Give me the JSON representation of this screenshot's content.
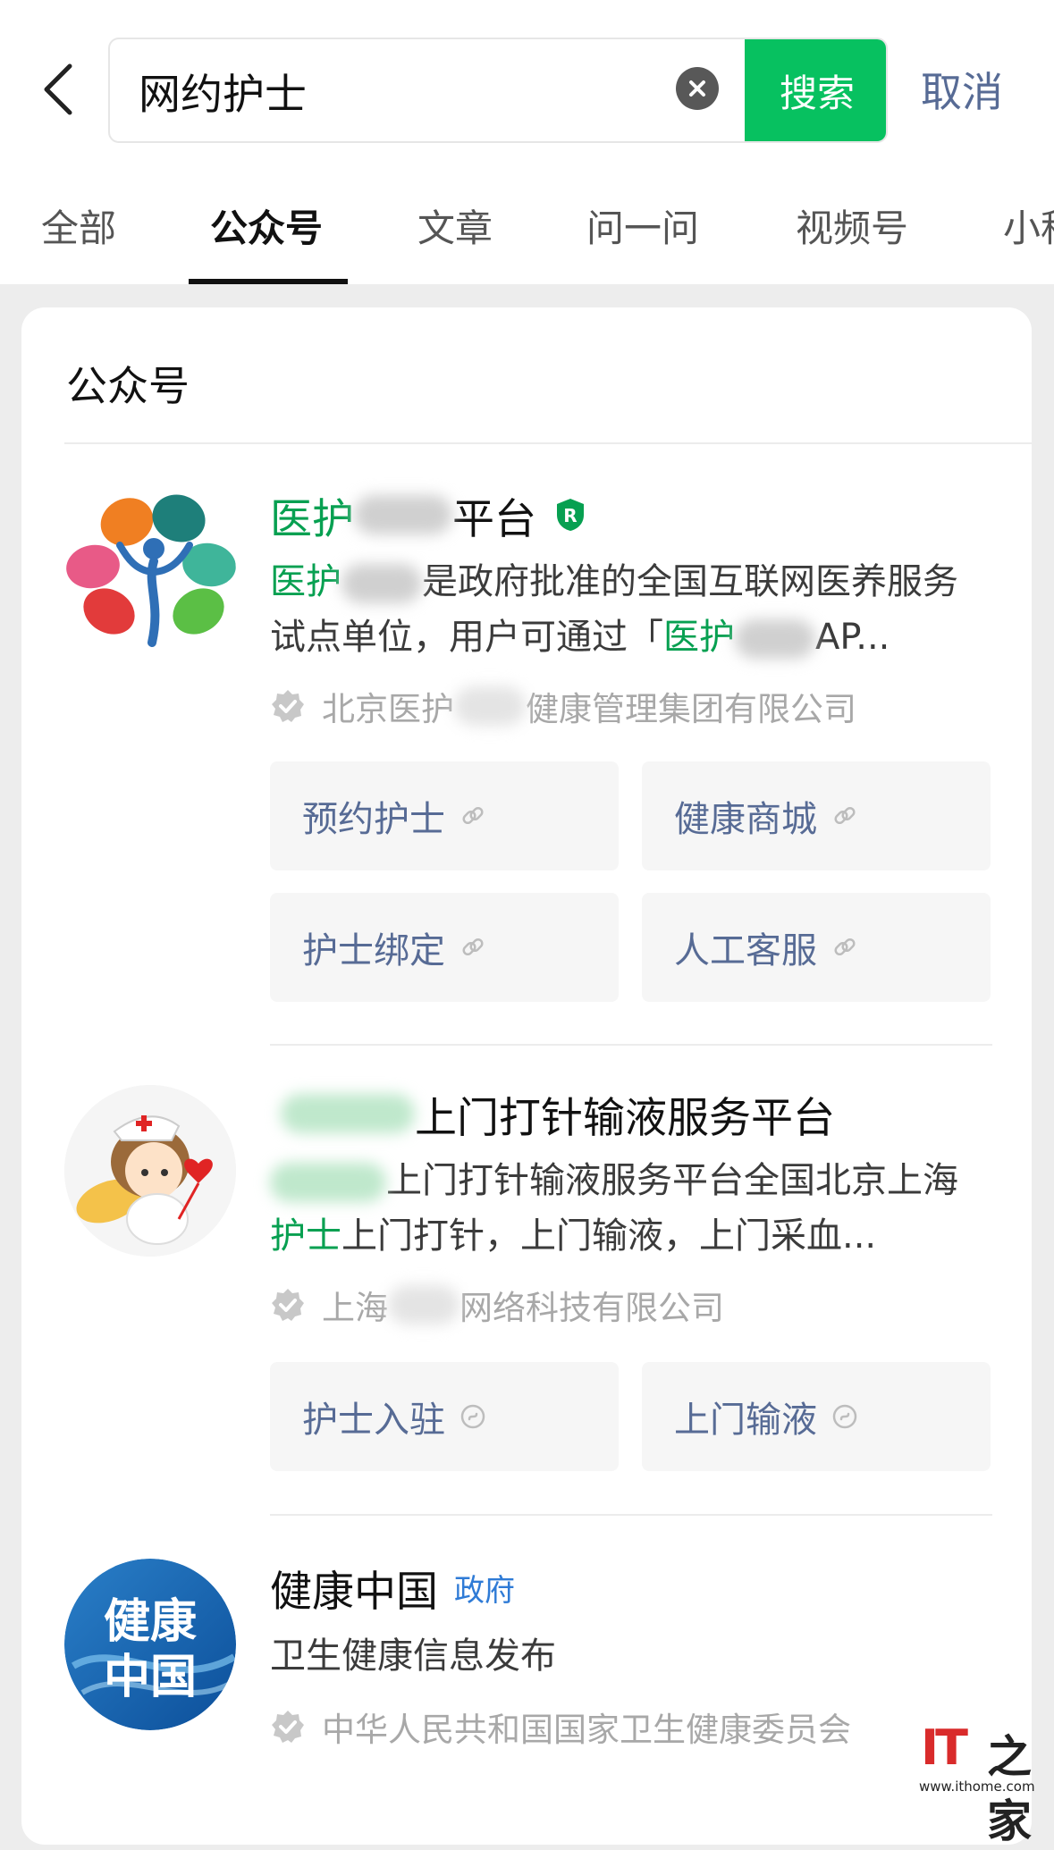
{
  "search": {
    "query": "网约护士",
    "submit_label": "搜索",
    "cancel_label": "取消"
  },
  "tabs": [
    {
      "label": "全部",
      "active": false
    },
    {
      "label": "公众号",
      "active": true
    },
    {
      "label": "文章",
      "active": false
    },
    {
      "label": "问一问",
      "active": false
    },
    {
      "label": "视频号",
      "active": false
    },
    {
      "label": "小程",
      "active": false
    }
  ],
  "results": {
    "section_title": "公众号",
    "accounts": [
      {
        "name_prefix": "医护",
        "name_suffix": "平台",
        "badge": "R",
        "desc_prefix": "医护",
        "desc_text": "是政府批准的全国互联网医养服务试点单位，用户可通过「",
        "desc_highlight": "医护",
        "desc_end": "AP...",
        "org_prefix": "北京医护",
        "org_suffix": "健康管理集团有限公司",
        "menu": [
          "预约护士",
          "健康商城",
          "护士绑定",
          "人工客服"
        ]
      },
      {
        "name_suffix": "上门打针输液服务平台",
        "desc_text": "上门打针输液服务平台全国北京上海",
        "desc_highlight": "护士",
        "desc_end": "上门打针，上门输液，上门采血...",
        "org_prefix": "上海",
        "org_suffix": "网络科技有限公司",
        "menu": [
          "护士入驻",
          "上门输液"
        ]
      },
      {
        "name": "健康中国",
        "badge": "政府",
        "avatar_text_top": "健康",
        "avatar_text_bottom": "中国",
        "desc_text": "卫生健康信息发布",
        "org": "中华人民共和国国家卫生健康委员会"
      }
    ]
  },
  "watermark": {
    "brand": "IT",
    "brand_zh": "之家",
    "url": "www.ithome.com"
  },
  "colors": {
    "accent_green": "#07c160",
    "highlight_green": "#07a051",
    "link_blue": "#576b95",
    "gov_blue": "#2f7bd6"
  }
}
